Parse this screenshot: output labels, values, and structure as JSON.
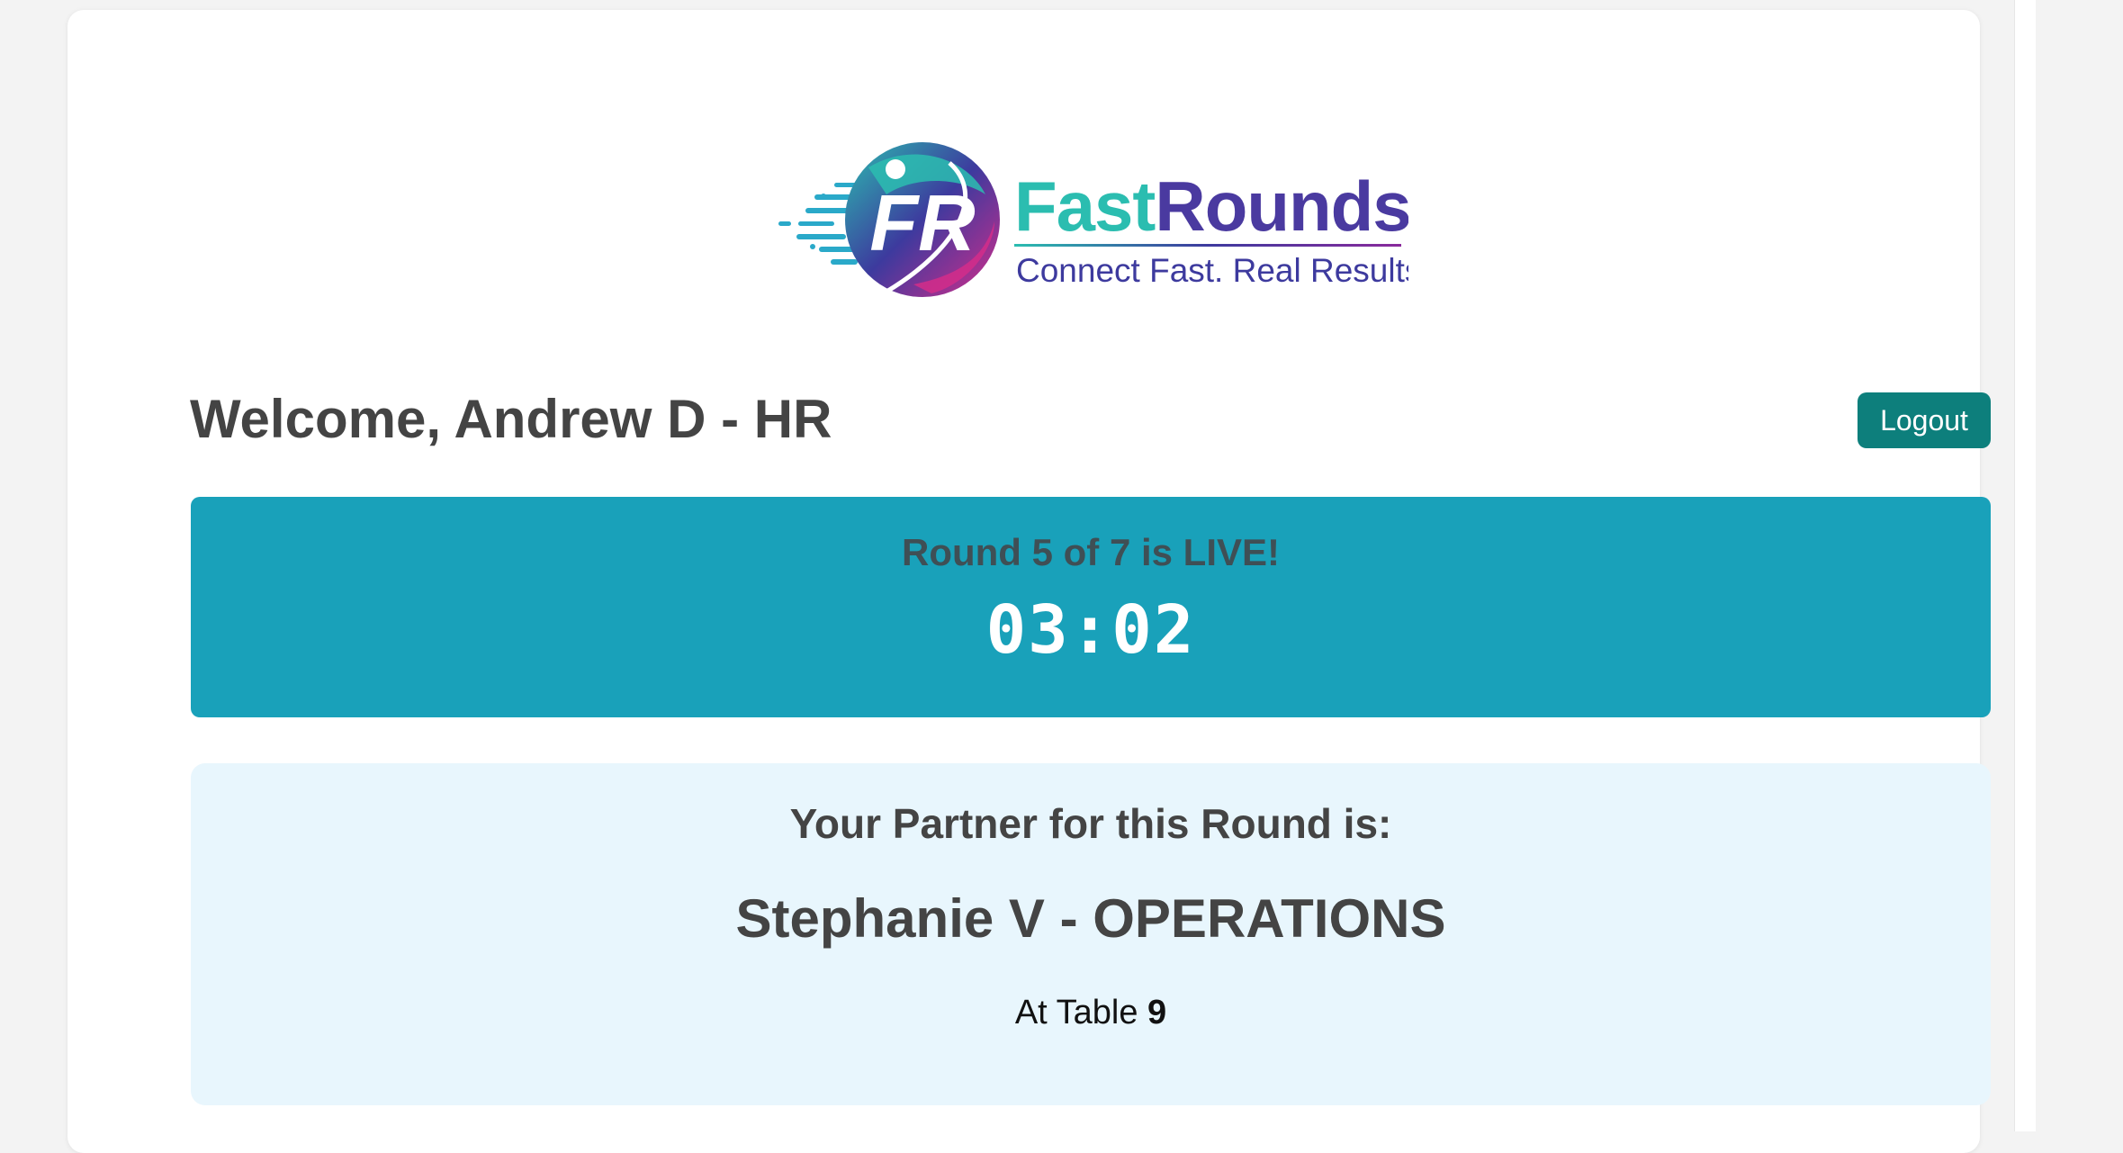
{
  "brand": {
    "logo_icon": "fast-rounds-logo-icon",
    "logo_monogram": "FR",
    "name_part1": "Fast",
    "name_part2": "Rounds",
    "tagline": "Connect Fast. Real Results.",
    "colors": {
      "teal": "#2bbdb0",
      "indigo": "#3d3a9e",
      "purple": "#8a2a9c",
      "magenta": "#d42d8a"
    }
  },
  "header": {
    "welcome_text": "Welcome, Andrew D - HR",
    "logout_label": "Logout",
    "logout_color": "#0d7f7c"
  },
  "round": {
    "status_text": "Round 5 of 7 is LIVE!",
    "timer": "03:02",
    "banner_color": "#19a1ba"
  },
  "partner": {
    "heading": "Your Partner for this Round is:",
    "name": "Stephanie V - OPERATIONS",
    "table_prefix": "At Table",
    "table_number": "9",
    "panel_color": "#e8f6fd"
  }
}
